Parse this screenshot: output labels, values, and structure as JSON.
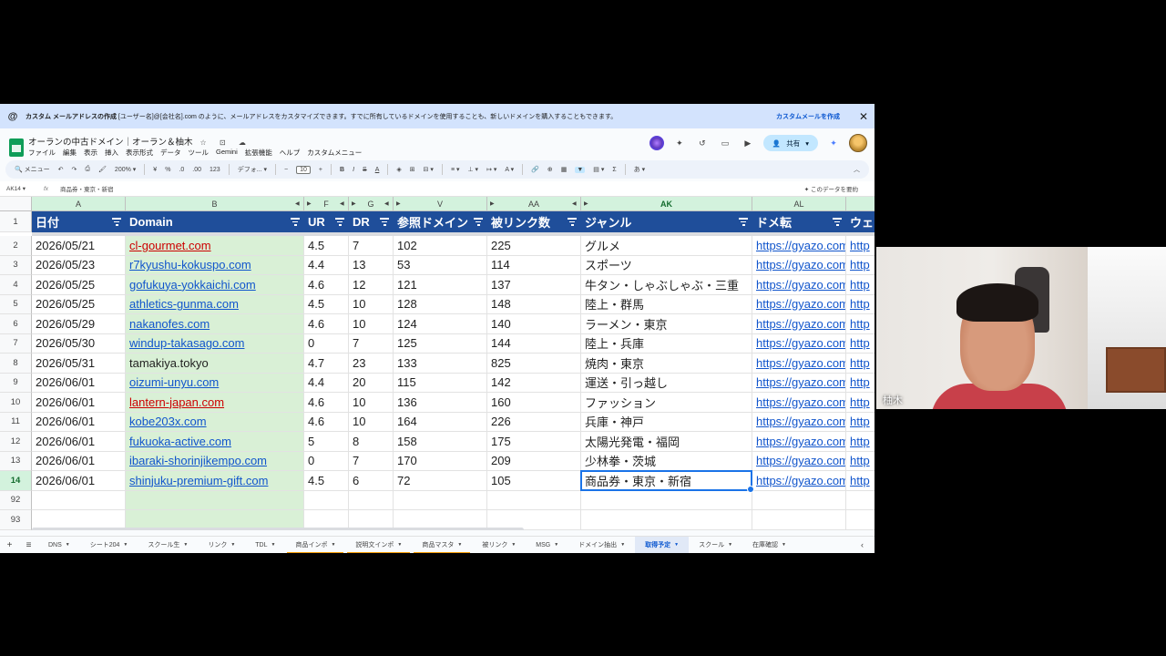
{
  "banner": {
    "title": "カスタム メールアドレスの作成",
    "message": " [ユーザー名]@[会社名].com のように、メールアドレスをカスタマイズできます。すでに所有しているドメインを使用することも、新しいドメインを購入することもできます。",
    "cta": "カスタムメールを作成",
    "close": "✕"
  },
  "doc": {
    "title": "オーランの中古ドメイン｜オーラン＆柚木",
    "title_icons": "☆ ⊡ ☁"
  },
  "menu": [
    "ファイル",
    "編集",
    "表示",
    "挿入",
    "表示形式",
    "データ",
    "ツール",
    "Gemini",
    "拡張機能",
    "ヘルプ",
    "カスタムメニュー"
  ],
  "top_right": {
    "share_label": "共有"
  },
  "toolbar": {
    "search": "メニュー",
    "zoom": "200%",
    "currency": "¥",
    "percent": "%",
    "dec_down": ".0",
    "dec_up": ".00",
    "num": "123",
    "font": "デフォ...",
    "font_size": "10"
  },
  "formula_bar": {
    "cell_ref": "AK14",
    "fx": "fx",
    "value": "商品券・東京・新宿",
    "summarize": "✦ このデータを要約"
  },
  "columns": [
    {
      "letter": "A",
      "header": "日付"
    },
    {
      "letter": "B",
      "header": "Domain"
    },
    {
      "letter": "F",
      "header": "UR"
    },
    {
      "letter": "G",
      "header": "DR"
    },
    {
      "letter": "V",
      "header": "参照ドメイン"
    },
    {
      "letter": "AA",
      "header": "被リンク数"
    },
    {
      "letter": "AK",
      "header": "ジャンル"
    },
    {
      "letter": "AL",
      "header": "ドメ転"
    },
    {
      "letter": "",
      "header": "ウェ"
    }
  ],
  "rows": [
    {
      "num": "2",
      "date": "2026/05/21",
      "domain": "cl-gourmet.com",
      "domain_style": "red",
      "ur": "4.5",
      "dr": "7",
      "ref": "102",
      "bl": "225",
      "genre": "グルメ"
    },
    {
      "num": "3",
      "date": "2026/05/23",
      "domain": "r7kyushu-kokuspo.com",
      "domain_style": "link",
      "ur": "4.4",
      "dr": "13",
      "ref": "53",
      "bl": "114",
      "genre": "スポーツ"
    },
    {
      "num": "4",
      "date": "2026/05/25",
      "domain": "gofukuya-yokkaichi.com",
      "domain_style": "link",
      "ur": "4.6",
      "dr": "12",
      "ref": "121",
      "bl": "137",
      "genre": "牛タン・しゃぶしゃぶ・三重"
    },
    {
      "num": "5",
      "date": "2026/05/25",
      "domain": "athletics-gunma.com",
      "domain_style": "link",
      "ur": "4.5",
      "dr": "10",
      "ref": "128",
      "bl": "148",
      "genre": "陸上・群馬"
    },
    {
      "num": "6",
      "date": "2026/05/29",
      "domain": "nakanofes.com",
      "domain_style": "link",
      "ur": "4.6",
      "dr": "10",
      "ref": "124",
      "bl": "140",
      "genre": "ラーメン・東京"
    },
    {
      "num": "7",
      "date": "2026/05/30",
      "domain": "windup-takasago.com",
      "domain_style": "link",
      "ur": "0",
      "dr": "7",
      "ref": "125",
      "bl": "144",
      "genre": "陸上・兵庫"
    },
    {
      "num": "8",
      "date": "2026/05/31",
      "domain": "tamakiya.tokyo",
      "domain_style": "plain",
      "ur": "4.7",
      "dr": "23",
      "ref": "133",
      "bl": "825",
      "genre": "焼肉・東京"
    },
    {
      "num": "9",
      "date": "2026/06/01",
      "domain": "oizumi-unyu.com",
      "domain_style": "link",
      "ur": "4.4",
      "dr": "20",
      "ref": "115",
      "bl": "142",
      "genre": "運送・引っ越し"
    },
    {
      "num": "10",
      "date": "2026/06/01",
      "domain": "lantern-japan.com",
      "domain_style": "red",
      "ur": "4.6",
      "dr": "10",
      "ref": "136",
      "bl": "160",
      "genre": "ファッション"
    },
    {
      "num": "11",
      "date": "2026/06/01",
      "domain": "kobe203x.com",
      "domain_style": "link",
      "ur": "4.6",
      "dr": "10",
      "ref": "164",
      "bl": "226",
      "genre": "兵庫・神戸"
    },
    {
      "num": "12",
      "date": "2026/06/01",
      "domain": "fukuoka-active.com",
      "domain_style": "link",
      "ur": "5",
      "dr": "8",
      "ref": "158",
      "bl": "175",
      "genre": "太陽光発電・福岡"
    },
    {
      "num": "13",
      "date": "2026/06/01",
      "domain": "ibaraki-shorinjikempo.com",
      "domain_style": "link",
      "ur": "0",
      "dr": "7",
      "ref": "170",
      "bl": "209",
      "genre": "少林拳・茨城"
    },
    {
      "num": "14",
      "date": "2026/06/01",
      "domain": "shinjuku-premium-gift.com",
      "domain_style": "link",
      "ur": "4.5",
      "dr": "6",
      "ref": "72",
      "bl": "105",
      "genre": "商品券・東京・新宿"
    }
  ],
  "link_text": "https://gyazo.com",
  "link_text_short": "http",
  "extra_rows": [
    "92",
    "93"
  ],
  "sheet_tabs": [
    {
      "label": "DNS",
      "style": ""
    },
    {
      "label": "シート204",
      "style": ""
    },
    {
      "label": "スクール生",
      "style": ""
    },
    {
      "label": "リンク",
      "style": ""
    },
    {
      "label": "TDL",
      "style": ""
    },
    {
      "label": "商品インポ",
      "style": "orange"
    },
    {
      "label": "説明文インポ",
      "style": "orange"
    },
    {
      "label": "商品マスタ",
      "style": "orange"
    },
    {
      "label": "被リンク",
      "style": ""
    },
    {
      "label": "MSG",
      "style": ""
    },
    {
      "label": "ドメイン抽出",
      "style": ""
    },
    {
      "label": "取得予定",
      "style": "active"
    },
    {
      "label": "スクール",
      "style": ""
    },
    {
      "label": "在庫確認",
      "style": ""
    }
  ],
  "video": {
    "participant_name": "柚木"
  }
}
